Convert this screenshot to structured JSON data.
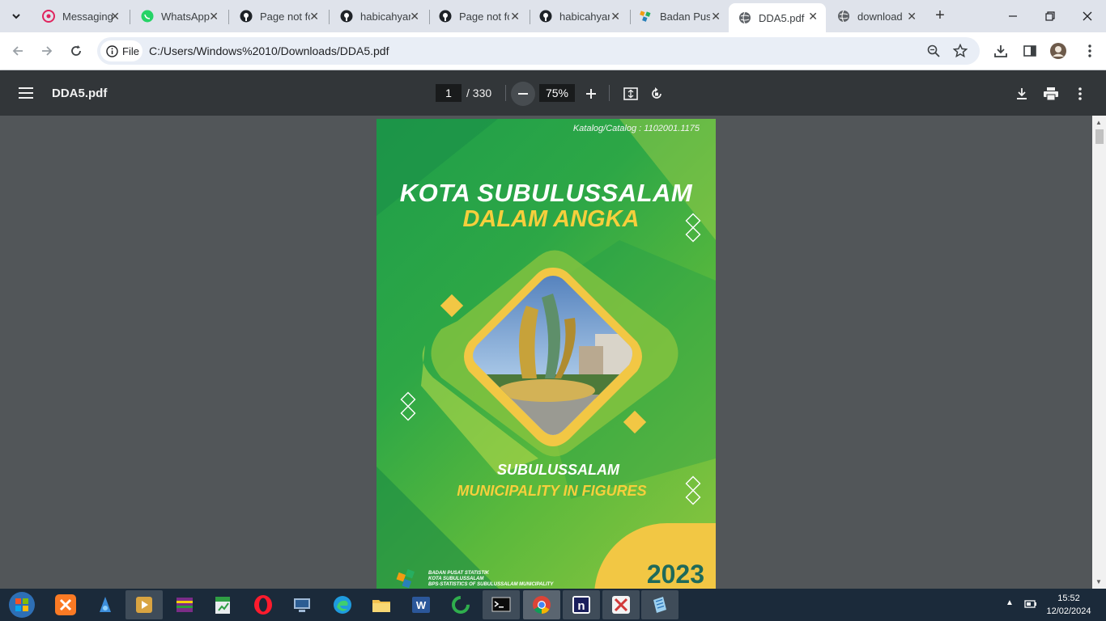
{
  "browser": {
    "tabs": [
      {
        "title": "Messaging",
        "icon": "messenger-icon",
        "active": false
      },
      {
        "title": "WhatsApp",
        "icon": "whatsapp-icon",
        "active": false
      },
      {
        "title": "Page not found",
        "icon": "github-icon",
        "active": false
      },
      {
        "title": "habicahyani",
        "icon": "github-icon",
        "active": false
      },
      {
        "title": "Page not found",
        "icon": "github-icon",
        "active": false
      },
      {
        "title": "habicahyani",
        "icon": "github-icon",
        "active": false
      },
      {
        "title": "Badan Pusat",
        "icon": "bps-icon",
        "active": false
      },
      {
        "title": "DDA5.pdf",
        "icon": "globe-icon",
        "active": true
      },
      {
        "title": "download",
        "icon": "globe-icon",
        "active": false
      }
    ],
    "address": {
      "chip_label": "File",
      "url": "C:/Users/Windows%2010/Downloads/DDA5.pdf"
    }
  },
  "pdf_toolbar": {
    "filename": "DDA5.pdf",
    "current_page": "1",
    "page_total": "/ 330",
    "zoom": "75%"
  },
  "cover": {
    "catalog": "Katalog/Catalog : 1102001.1175",
    "title_line1": "KOTA SUBULUSSALAM",
    "title_line2": "DALAM ANGKA",
    "subtitle_line1": "SUBULUSSALAM",
    "subtitle_line2": "MUNICIPALITY IN FIGURES",
    "year": "2023",
    "publisher_line1": "BADAN PUSAT STATISTIK",
    "publisher_line2": "KOTA SUBULUSSALAM",
    "publisher_line3": "BPS-STATISTICS OF SUBULUSSALAM MUNICIPALITY"
  },
  "taskbar": {
    "time": "15:52",
    "date": "12/02/2024",
    "apps": [
      "start-icon",
      "xampp-icon",
      "recycle-icon",
      "media-player-icon",
      "winrar-icon",
      "spreadsheet-icon",
      "opera-icon",
      "network-icon",
      "edge-icon",
      "file-explorer-icon",
      "word-icon",
      "loading-app-icon",
      "terminal-icon",
      "chrome-icon",
      "notion-icon",
      "xmind-icon",
      "notepad-icon"
    ]
  },
  "colors": {
    "tabstrip": "#dfe3eb",
    "pdf_toolbar": "#323639",
    "viewer_bg": "#525659",
    "cover_green": "#2da746",
    "cover_yellow": "#f6cf3c",
    "year_color": "#1f6a5a"
  }
}
